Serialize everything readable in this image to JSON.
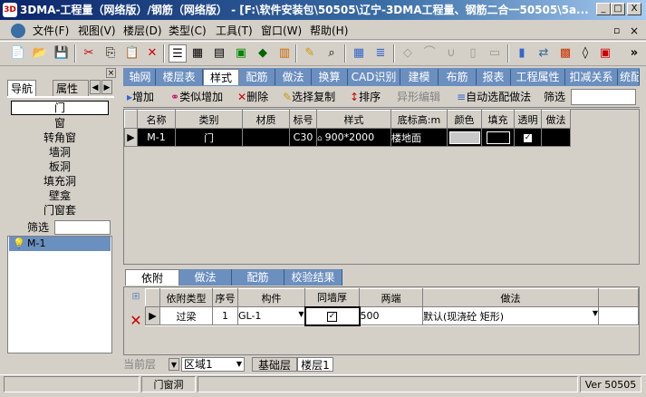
{
  "window": {
    "title": "3DMA-工程量（网络版）/钢筋（网络版） - [F:\\软件安装包\\50505\\辽宁-3DMA工程量、钢筋二合一50505\\5a...",
    "min": "_",
    "max": "□",
    "close": "X"
  },
  "menu": [
    "文件(F)",
    "视图(V)",
    "楼层(D)",
    "类型(C)",
    "工具(T)",
    "窗口(W)",
    "帮助(H)"
  ],
  "menu_right": {
    "restore": "▫",
    "close": "×"
  },
  "toolbar_more": "»",
  "left": {
    "tabs": [
      "导航",
      "属性窗"
    ],
    "selected": "门",
    "items": [
      "窗",
      "转角窗",
      "墙洞",
      "板洞",
      "填充洞",
      "壁龛",
      "门窗套"
    ],
    "filter_label": "筛选",
    "filter_value": "",
    "tree_item": "M-1"
  },
  "tabs": [
    "轴网",
    "楼层表",
    "样式",
    "配筋",
    "做法",
    "换算",
    "CAD识别",
    "建模",
    "布筋",
    "报表",
    "工程属性",
    "扣减关系",
    "统配"
  ],
  "subtoolbar": {
    "add": "增加",
    "similar_add": "类似增加",
    "delete": "删除",
    "copy": "选择复制",
    "sort": "排序",
    "abnormal": "异形编辑",
    "auto": "自动选配做法",
    "filter": "筛选",
    "filter_value": ""
  },
  "grid": {
    "headers": [
      "名称",
      "类别",
      "材质",
      "标号",
      "样式",
      "底标高:m",
      "颜色",
      "填充",
      "透明",
      "做法"
    ],
    "row": {
      "name": "M-1",
      "category": "门",
      "material": "",
      "grade": "C30",
      "style": "900*2000",
      "elevation": "楼地面",
      "transparent": "✓"
    }
  },
  "bottom_tabs": [
    "依附",
    "做法",
    "配筋",
    "校验结果"
  ],
  "bgrid": {
    "headers": [
      "依附类型",
      "序号",
      "构件",
      "同墙厚",
      "两端",
      "做法"
    ],
    "row": {
      "type": "过梁",
      "index": "1",
      "component": "GL-1",
      "same_thick": "✓",
      "ends": "500",
      "method": "默认(现浇砼 矩形)"
    }
  },
  "footer": {
    "layer_label": "当前层",
    "region": "区域1",
    "tabs": [
      "基础层",
      "楼层1"
    ]
  },
  "status": {
    "middle": "门窗洞",
    "version": "Ver 50505"
  }
}
